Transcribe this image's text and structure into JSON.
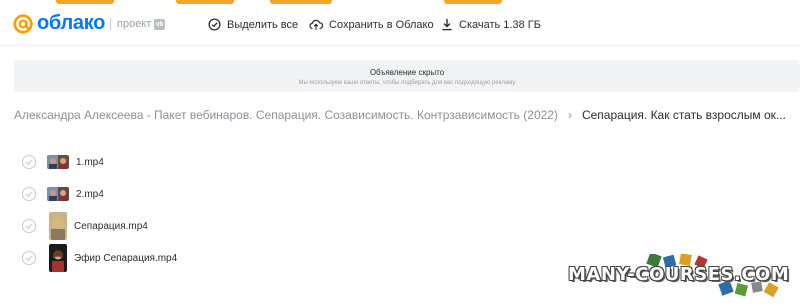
{
  "header": {
    "logo_text": "облако",
    "project_label": "проект",
    "project_badge": "vk",
    "actions": {
      "select_all": "Выделить все",
      "save_to_cloud": "Сохранить в Облако",
      "download": "Скачать 1.38 ГБ"
    }
  },
  "ad": {
    "title": "Объявление скрыто",
    "subtitle": "Мы используем ваши ответы, чтобы подбирать для вас подходящую рекламу"
  },
  "breadcrumb": {
    "parent": "Александра Алексеева - Пакет вебинаров. Сепарация. Созависимость. Контрзависимость (2022)",
    "separator": "›",
    "current": "Сепарация. Как стать взрослым ок..."
  },
  "files": [
    {
      "name": "1.mp4"
    },
    {
      "name": "2.mp4"
    },
    {
      "name": "Сепарация.mp4"
    },
    {
      "name": "Эфир Сепарация.mp4"
    }
  ],
  "watermark": {
    "text": "MANY-COURSES.COM"
  },
  "colors": {
    "brand": "#0077ff",
    "accent_strip": "#f3a728"
  }
}
